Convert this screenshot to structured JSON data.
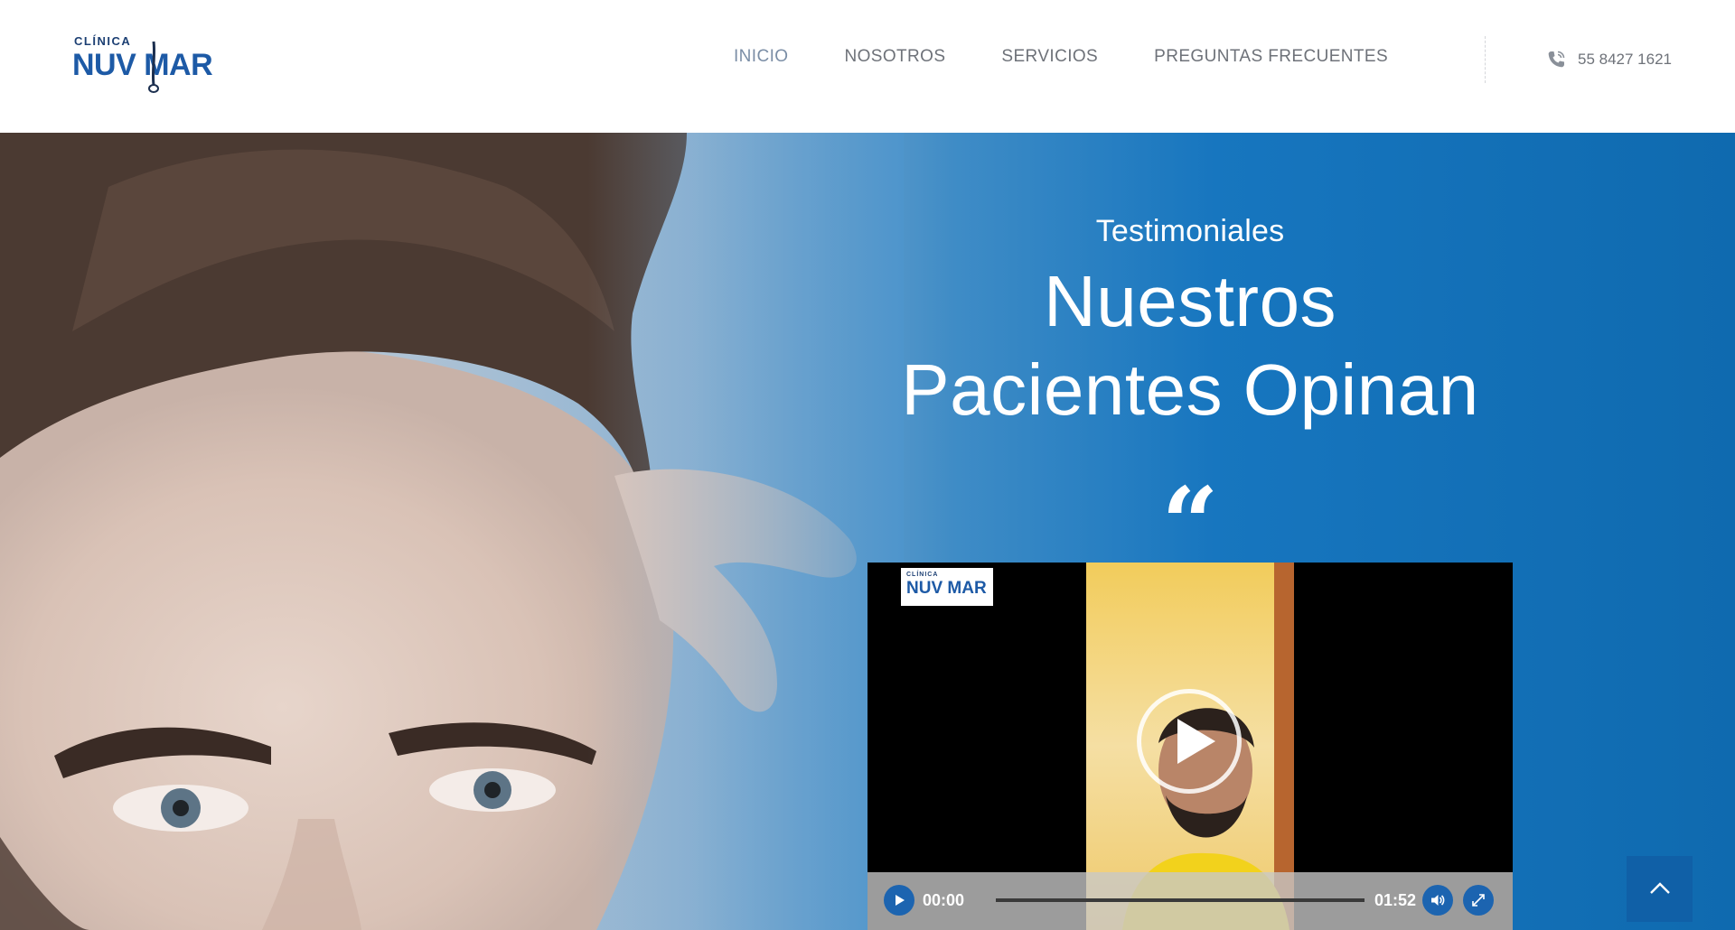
{
  "header": {
    "logo": {
      "small": "CLÍNICA",
      "big": "NUV MAR"
    },
    "nav": [
      {
        "label": "INICIO",
        "active": true
      },
      {
        "label": "NOSOTROS",
        "active": false
      },
      {
        "label": "SERVICIOS",
        "active": false
      },
      {
        "label": "PREGUNTAS FRECUENTES",
        "active": false
      }
    ],
    "phone": {
      "icon": "phone-icon",
      "number": "55 8427 1621"
    }
  },
  "hero": {
    "kicker": "Testimoniales",
    "headline_line1": "Nuestros",
    "headline_line2": "Pacientes Opinan",
    "quote_mark": "“"
  },
  "video": {
    "watermark": {
      "small": "CLÍNICA",
      "big": "NUV MAR"
    },
    "current_time": "00:00",
    "duration": "01:52",
    "progress": 0
  },
  "colors": {
    "brand_blue": "#1d5aa6",
    "nav_text": "#6e7279",
    "nav_active": "#7b8ea6",
    "hero_blue": "#1776bf",
    "control_blue": "#1c64b0"
  }
}
